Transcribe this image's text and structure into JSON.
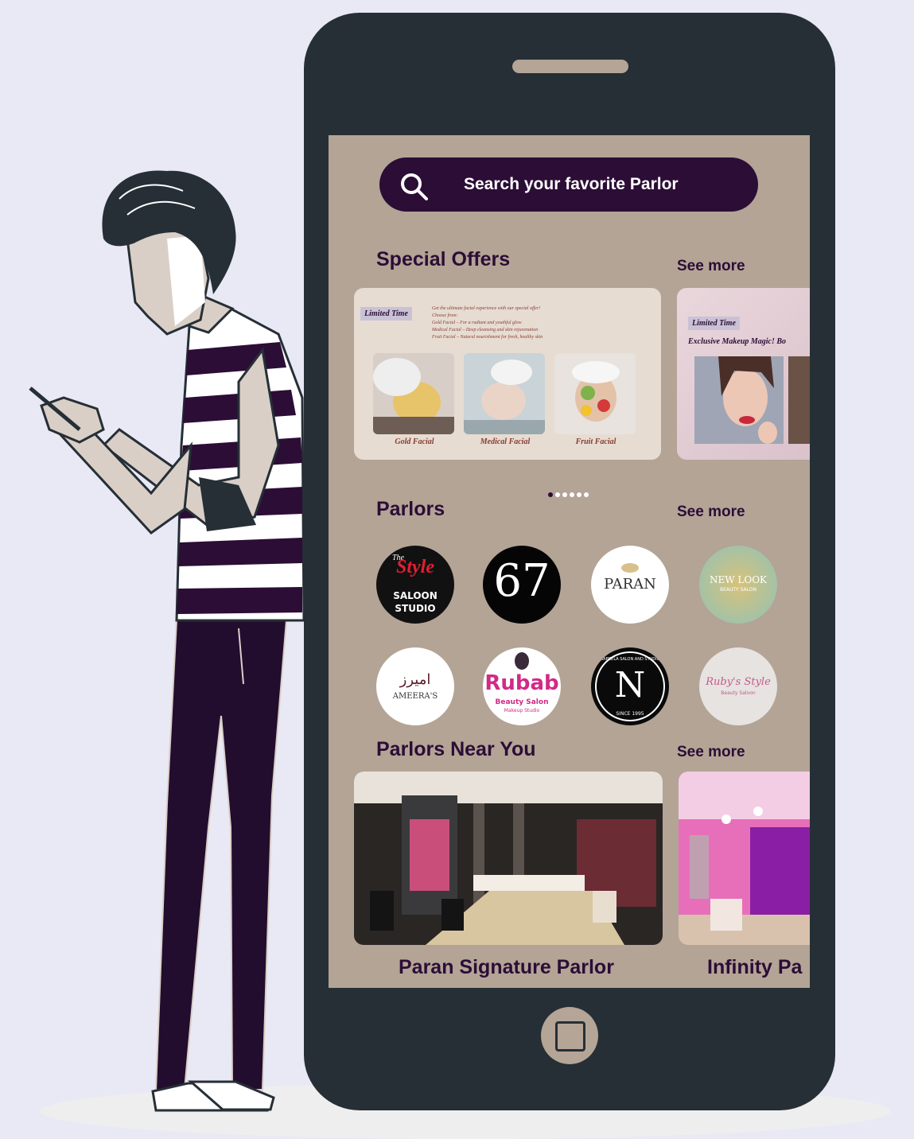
{
  "app": {
    "search": {
      "placeholder": "Search your favorite Parlor"
    },
    "sections": {
      "special_offers": {
        "title": "Special Offers",
        "see_more": "See more"
      },
      "parlors": {
        "title": "Parlors",
        "see_more": "See more"
      },
      "near": {
        "title": "Parlors Near You",
        "see_more": "See more"
      }
    },
    "offers": [
      {
        "badge": "Limited Time",
        "copy": [
          "Get the ultimate facial experience with our special offer!",
          "Choose from:",
          "Gold Facial – For a radiant and youthful glow",
          "Medical Facial – Deep cleansing and skin rejuvenation",
          "Fruit Facial – Natural nourishment for fresh, healthy skin"
        ],
        "items": [
          "Gold Facial",
          "Medical Facial",
          "Fruit Facial"
        ]
      },
      {
        "badge": "Limited Time",
        "title": "Exclusive Makeup Magic! Bo"
      }
    ],
    "carousel": {
      "dot_count": 6,
      "active_index": 0
    },
    "parlor_logos": [
      {
        "name": "The Style Saloon Studio",
        "line1": "The",
        "line2": "Style",
        "line3": "SALOON",
        "line4": "STUDIO"
      },
      {
        "name": "G7",
        "mark": "67"
      },
      {
        "name": "Paran",
        "text": "PARAN"
      },
      {
        "name": "New Look",
        "text": "NEW LOOK",
        "sub": "BEAUTY SALON"
      },
      {
        "name": "Ameera's",
        "arabic": "اميرز",
        "text": "AMEERA'S"
      },
      {
        "name": "Rubab",
        "text": "Rubab",
        "sub1": "Beauty Salon",
        "sub2": "Makeup Studio"
      },
      {
        "name": "Nabeela Salon and Studio",
        "ring_top": "NABEELA SALON AND STUDIO",
        "ring_bottom": "SINCE 1995",
        "mark": "N"
      },
      {
        "name": "Ruby's Style",
        "text": "Ruby's Style",
        "sub": "Beauty Saloon"
      }
    ],
    "near_you": [
      {
        "name": "Paran Signature Parlor"
      },
      {
        "name": "Infinity Pa"
      }
    ]
  },
  "colors": {
    "background": "#e9e9f5",
    "phone_body": "#262f36",
    "screen": "#b3a496",
    "accent": "#2c0d36",
    "phone_details": "#b5a597"
  },
  "icons": [
    "search-icon",
    "home-button-icon"
  ]
}
